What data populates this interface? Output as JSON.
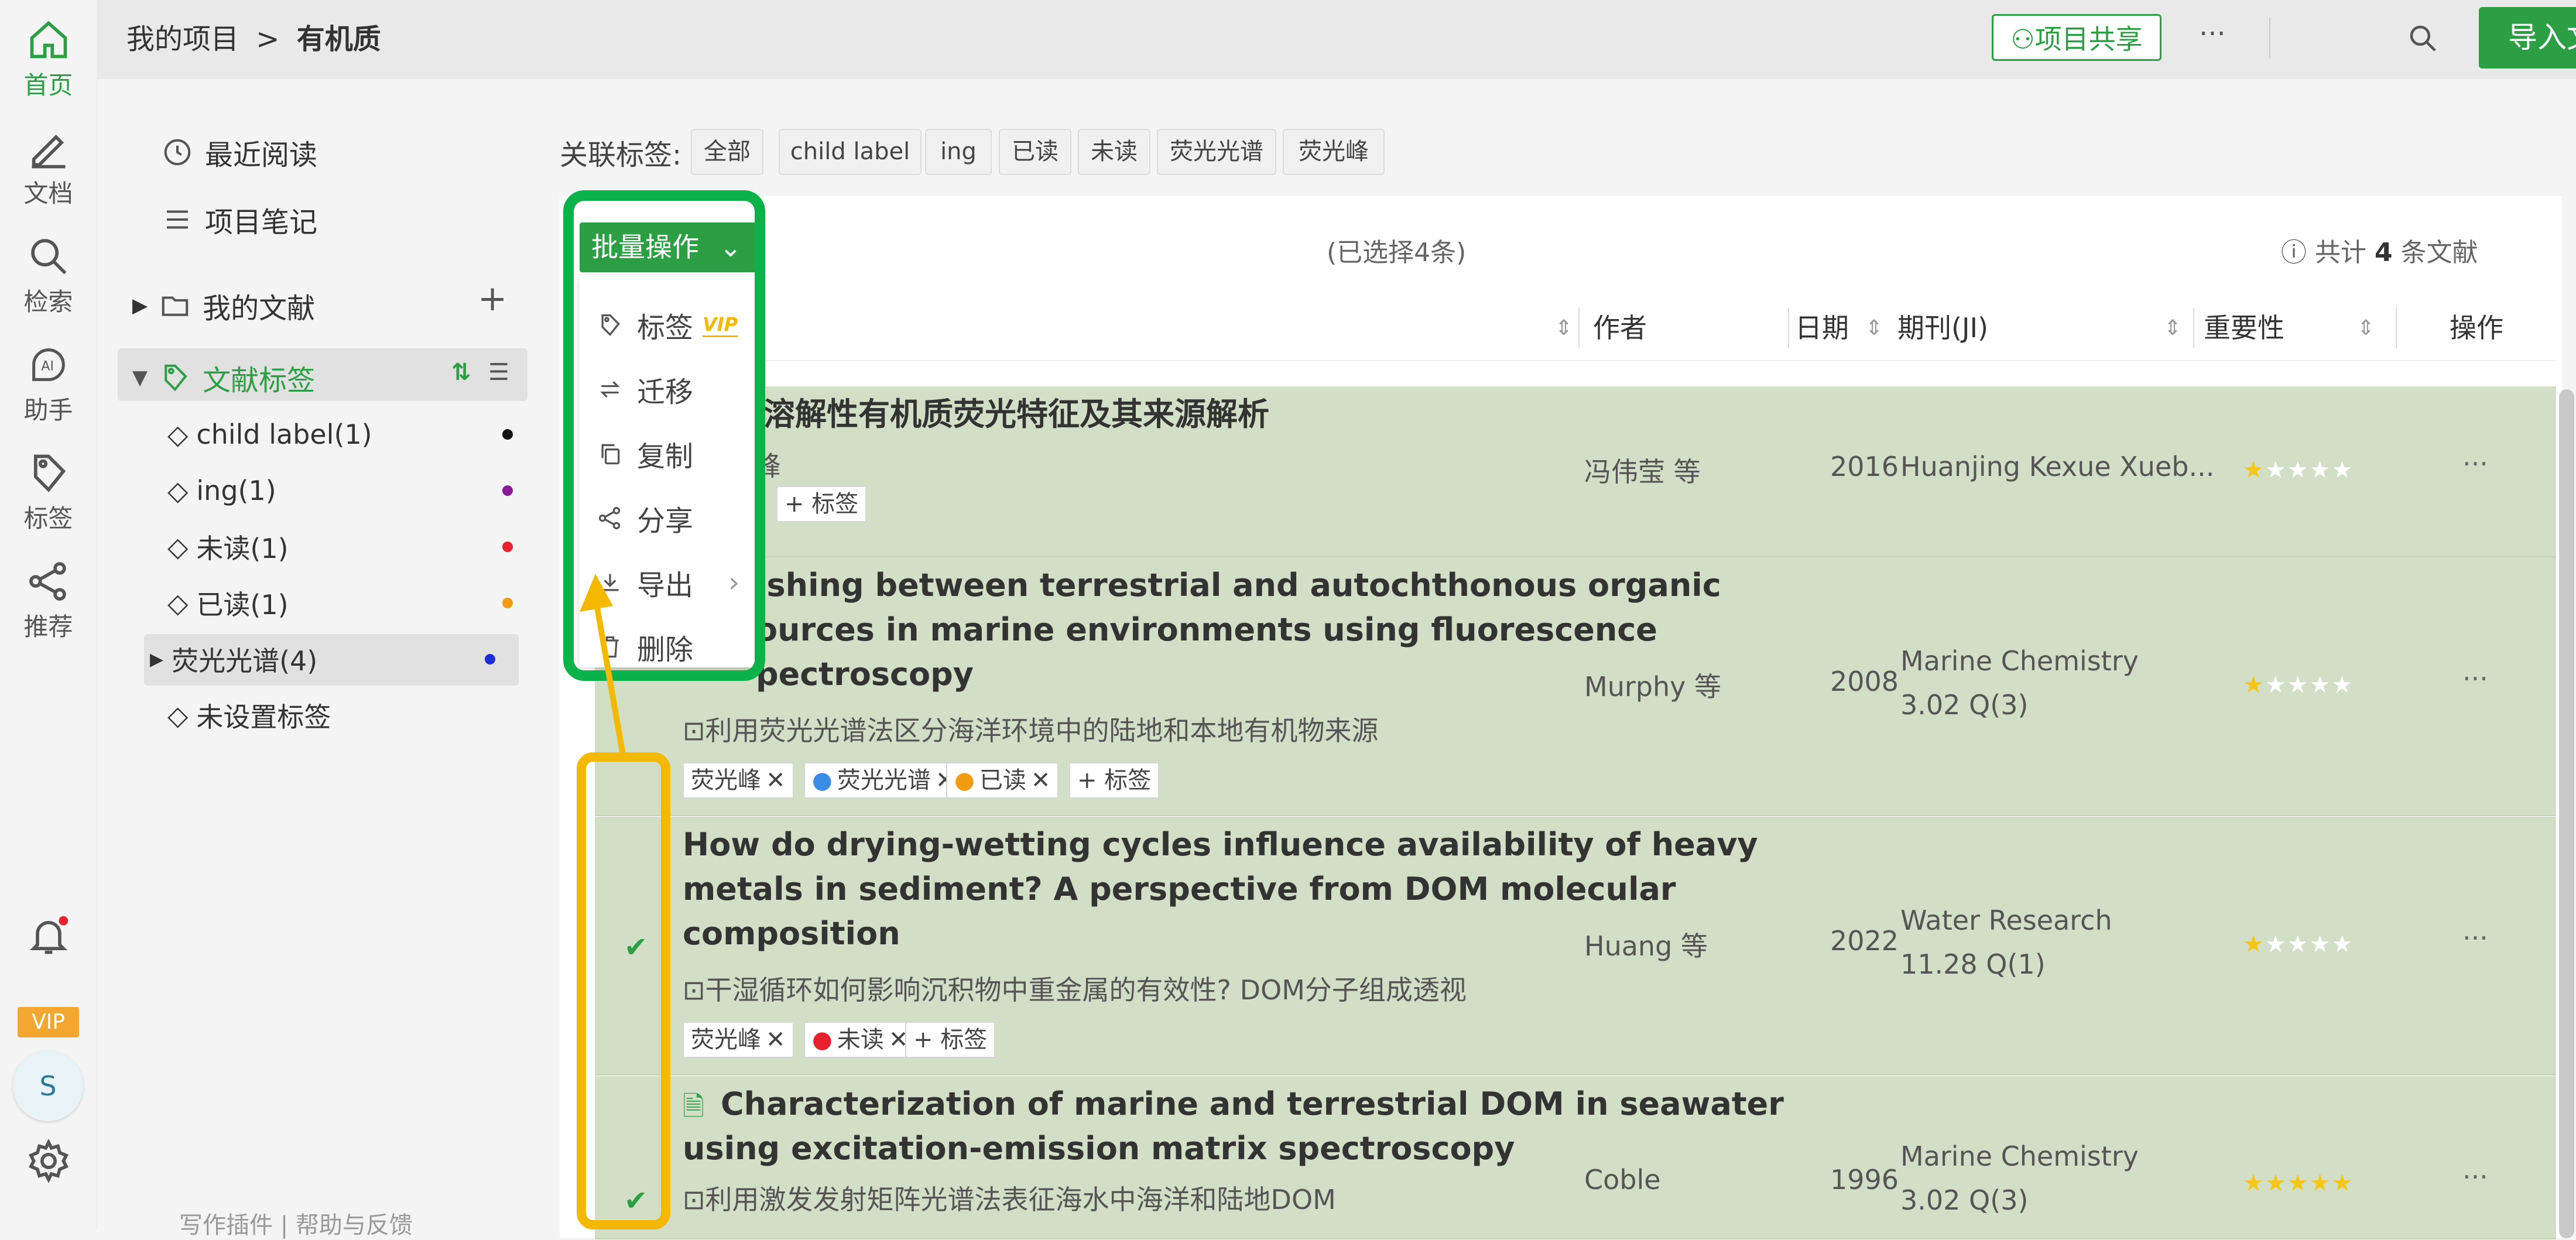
{
  "rail": {
    "items": [
      {
        "label": "首页",
        "icon": "home-icon"
      },
      {
        "label": "文档",
        "icon": "pencil-icon"
      },
      {
        "label": "检索",
        "icon": "search-icon"
      },
      {
        "label": "助手",
        "icon": "ai-assistant-icon"
      },
      {
        "label": "标签",
        "icon": "tag-icon"
      },
      {
        "label": "推荐",
        "icon": "share-icon"
      }
    ],
    "vip": "VIP",
    "avatar": "S"
  },
  "topbar": {
    "breadcrumb_root": "我的项目",
    "breadcrumb_sep": ">",
    "breadcrumb_current": "有机质",
    "share_btn": "项目共享",
    "more": "···",
    "import_btn": "导入文献"
  },
  "leftnav": {
    "recent": "最近阅读",
    "notes": "项目笔记",
    "my_docs": "我的文献",
    "doc_tags": "文献标签",
    "tags": [
      {
        "label": "child label(1)",
        "color": "#111111"
      },
      {
        "label": "ing(1)",
        "color": "#8b1a9a"
      },
      {
        "label": "未读(1)",
        "color": "#e8212e"
      },
      {
        "label": "已读(1)",
        "color": "#f39c12"
      },
      {
        "label": "荧光光谱(4)",
        "color": "#1e2fd8"
      },
      {
        "label": "未设置标签",
        "color": ""
      }
    ],
    "footer": "写作插件 | 帮助与反馈"
  },
  "filter": {
    "label": "关联标签:",
    "chips": [
      "全部",
      "child label",
      "ing",
      "已读",
      "未读",
      "荧光光谱",
      "荧光峰"
    ]
  },
  "batch": {
    "button": "批量操作",
    "selected": "(已选择4条)",
    "total_prefix": "共计",
    "total_count": "4",
    "total_suffix": "条文献"
  },
  "dropdown": {
    "items": [
      "标签",
      "迁移",
      "复制",
      "分享",
      "导出",
      "删除"
    ],
    "vip_badge": "VIP"
  },
  "columns": {
    "author": "作者",
    "date": "日期",
    "journal": "期刊(JI)",
    "importance": "重要性",
    "action": "操作"
  },
  "rows": [
    {
      "title": "水体溶解性有机质荧光特征及其来源解析",
      "subtitle": "荧光峰",
      "tags": [],
      "add_tag": "+ 标签",
      "author": "冯伟莹 等",
      "year": "2016",
      "journal": "Huanjing Kexue Xueb...",
      "journal2": "",
      "stars": 1
    },
    {
      "title_lines": [
        "ishing between terrestrial and autochthonous organic",
        "ources in marine environments using fluorescence",
        "pectroscopy"
      ],
      "subtitle": "利用荧光光谱法区分海洋环境中的陆地和本地有机物来源",
      "tags": [
        "荧光峰",
        "荧光光谱",
        "已读"
      ],
      "add_tag": "+ 标签",
      "author": "Murphy 等",
      "year": "2008",
      "journal": "Marine Chemistry",
      "journal2": "3.02 Q(3)",
      "stars": 1
    },
    {
      "title_lines": [
        "How do drying-wetting cycles influence availability of heavy",
        "metals in sediment? A perspective from DOM molecular",
        "composition"
      ],
      "subtitle": "干湿循环如何影响沉积物中重金属的有效性? DOM分子组成透视",
      "tags": [
        "荧光峰",
        "未读"
      ],
      "add_tag": "+ 标签",
      "author": "Huang 等",
      "year": "2022",
      "journal": "Water Research",
      "journal2": "11.28 Q(1)",
      "stars": 1
    },
    {
      "title_lines": [
        "Characterization of marine and terrestrial DOM in seawater",
        "using excitation-emission matrix spectroscopy"
      ],
      "subtitle": "利用激发发射矩阵光谱法表征海水中海洋和陆地DOM",
      "tags": [],
      "add_tag": "",
      "author": "Coble",
      "year": "1996",
      "journal": "Marine Chemistry",
      "journal2": "3.02 Q(3)",
      "stars": 5
    }
  ],
  "colors": {
    "accent": "#2c9f45",
    "highlight_green": "#0bb24a",
    "highlight_yellow": "#f5b800",
    "row_bg": "#d2dec6"
  }
}
